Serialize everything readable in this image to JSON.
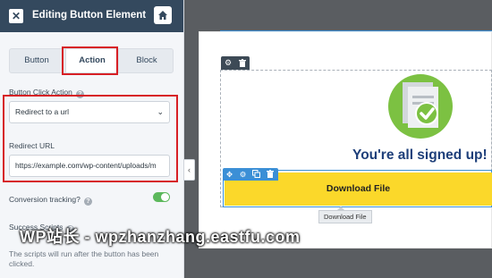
{
  "sidebar": {
    "header": {
      "close_icon": "close-icon",
      "title": "Editing Button Element",
      "home_icon": "home-icon"
    },
    "tabs": [
      {
        "label": "Button",
        "active": false
      },
      {
        "label": "Action",
        "active": true
      },
      {
        "label": "Block",
        "active": false
      }
    ],
    "button_click_action": {
      "label": "Button Click Action",
      "selected": "Redirect to a url"
    },
    "redirect_url": {
      "label": "Redirect URL",
      "value": "https://example.com/wp-content/uploads/m"
    },
    "conversion_tracking": {
      "label": "Conversion tracking?",
      "enabled": true
    },
    "success_scripts": {
      "label": "Success Scripts",
      "helper_text": "The scripts will run after the button has been clicked."
    }
  },
  "canvas": {
    "headline": "You're all signed up!",
    "button_label": "Download File",
    "tooltip": "Download File"
  },
  "watermark": "WP站长 - wpzhanzhang.eastfu.com",
  "colors": {
    "header_bg": "#34495e",
    "highlight": "#d71f25",
    "toggle_on": "#5cb85c",
    "button_bg": "#fbd82a",
    "headline": "#1e3f7a",
    "selection": "#3b8fd6",
    "icon_green": "#7cc142"
  }
}
